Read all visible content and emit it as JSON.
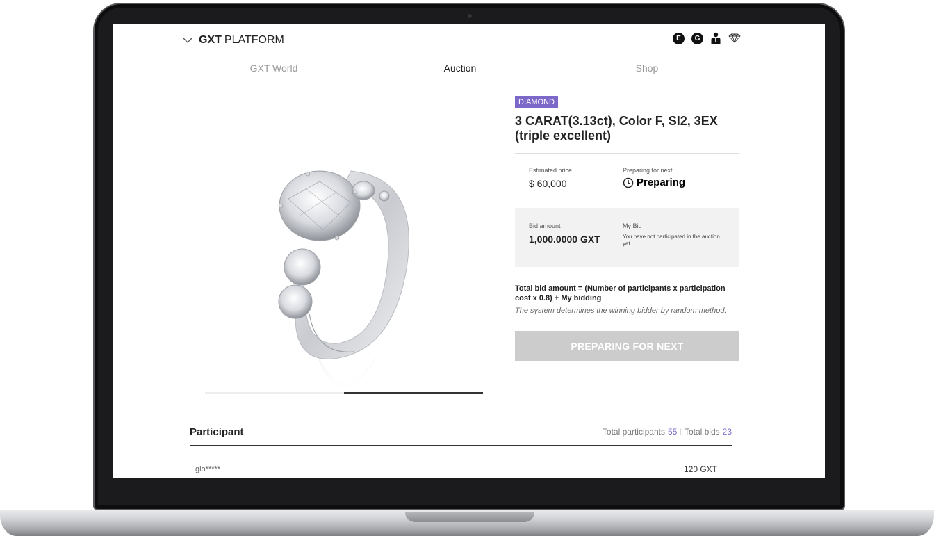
{
  "header": {
    "brand_bold": "GXT",
    "brand_rest": "PLATFORM",
    "icons": [
      {
        "name": "e-coin-icon",
        "letter": "E"
      },
      {
        "name": "g-coin-icon",
        "letter": "G"
      },
      {
        "name": "user-icon"
      },
      {
        "name": "diamond-icon"
      }
    ]
  },
  "nav": {
    "tabs": [
      {
        "label": "GXT World",
        "active": false
      },
      {
        "label": "Auction",
        "active": true
      },
      {
        "label": "Shop",
        "active": false
      }
    ]
  },
  "product": {
    "category": "DIAMOND",
    "title": "3 CARAT(3.13ct), Color F, SI2, 3EX (triple excellent)",
    "estimated_label": "Estimated price",
    "estimated_value": "$ 60,000",
    "status_label": "Preparing for next",
    "status_value": "Preparing",
    "bid_label": "Bid amount",
    "bid_value": "1,000.0000 GXT",
    "mybid_label": "My Bid",
    "mybid_note": "You have not participated in the auction yet.",
    "formula": "Total bid amount = (Number of participants x participation cost x 0.8) + My bidding",
    "note": "The system determines the winning bidder by random method.",
    "button_label": "PREPARING FOR NEXT",
    "image_slide": 2,
    "image_slide_count": 2
  },
  "participants": {
    "title": "Participant",
    "total_participants_label": "Total participants",
    "total_participants": "55",
    "total_bids_label": "Total bids",
    "total_bids": "23",
    "rows": [
      {
        "user": "glo*****",
        "amount": "120 GXT"
      }
    ]
  },
  "colors": {
    "accent": "#7c68c9",
    "button_disabled": "#cccccc",
    "panel_bg": "#f2f2f2"
  }
}
